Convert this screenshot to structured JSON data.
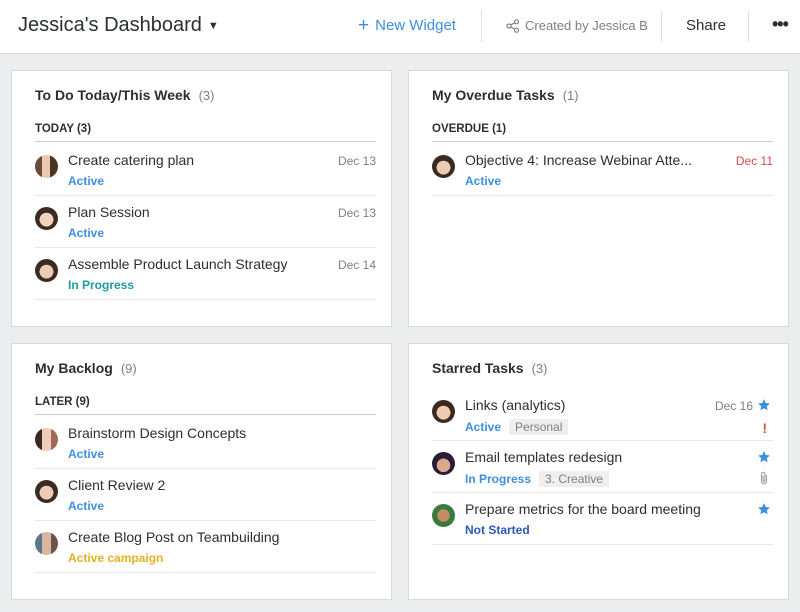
{
  "header": {
    "title": "Jessica's Dashboard",
    "new_widget": "New Widget",
    "created_by": "Created by Jessica B",
    "share": "Share",
    "more": "•••"
  },
  "widgets": {
    "todo": {
      "title": "To Do Today/This Week",
      "count": "(3)",
      "group": "TODAY (3)",
      "tasks": [
        {
          "name": "Create catering plan",
          "status": "Active",
          "date": "Dec 13"
        },
        {
          "name": "Plan Session",
          "status": "Active",
          "date": "Dec 13"
        },
        {
          "name": "Assemble Product Launch Strategy",
          "status": "In Progress",
          "date": "Dec 14"
        }
      ]
    },
    "overdue": {
      "title": "My Overdue Tasks",
      "count": "(1)",
      "group": "OVERDUE (1)",
      "tasks": [
        {
          "name": "Objective 4: Increase Webinar Atte...",
          "status": "Active",
          "date": "Dec 11"
        }
      ]
    },
    "backlog": {
      "title": "My Backlog",
      "count": "(9)",
      "group": "LATER (9)",
      "tasks": [
        {
          "name": "Brainstorm Design Concepts",
          "status": "Active"
        },
        {
          "name": "Client Review 2",
          "status": "Active"
        },
        {
          "name": "Create Blog Post on Teambuilding",
          "status": "Active campaign"
        }
      ]
    },
    "starred": {
      "title": "Starred Tasks",
      "count": "(3)",
      "tasks": [
        {
          "name": "Links (analytics)",
          "status": "Active",
          "tag": "Personal",
          "date": "Dec 16"
        },
        {
          "name": "Email templates redesign",
          "status": "In Progress",
          "tag": "3. Creative"
        },
        {
          "name": "Prepare metrics for the board meeting",
          "status": "Not Started"
        }
      ]
    }
  },
  "colors": {
    "accent": "#3e8ede",
    "status_active": "#3e8ede",
    "status_in_progress": "#1e9b9b",
    "status_active_campaign": "#e6b022",
    "status_not_started": "#2f57b5",
    "overdue_date": "#e04a4a",
    "star": "#3e8ede",
    "background": "#ecedee"
  },
  "icons": {
    "title_caret": "caret-down-icon",
    "new_widget": "plus-icon",
    "created_by": "share-nodes-icon",
    "more": "more-horizontal-icon",
    "star": "star-icon",
    "important": "exclamation-icon",
    "attachment": "paperclip-icon"
  }
}
